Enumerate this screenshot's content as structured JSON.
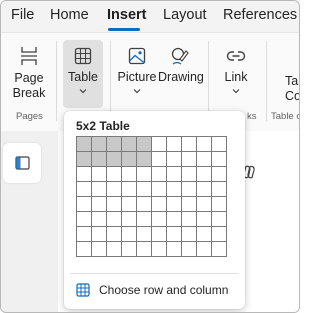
{
  "menubar": {
    "tabs": [
      {
        "label": "File"
      },
      {
        "label": "Home"
      },
      {
        "label": "Insert"
      },
      {
        "label": "Layout"
      },
      {
        "label": "References"
      }
    ],
    "active_tab": "Insert"
  },
  "ribbon": {
    "page_break": {
      "line1": "Page",
      "line2": "Break",
      "icon": "page-break-icon"
    },
    "table": {
      "label": "Table",
      "icon": "table-icon"
    },
    "picture": {
      "label": "Picture",
      "icon": "picture-icon"
    },
    "drawing": {
      "label": "Drawing",
      "icon": "drawing-icon"
    },
    "link": {
      "label": "Link",
      "icon": "link-icon"
    },
    "table_contents": {
      "line1": "Ta",
      "line2": "Co"
    },
    "groups": {
      "pages": "Pages",
      "links_partial": "ks",
      "table_contents_partial": "Table o"
    }
  },
  "table_dropdown": {
    "title": "5x2 Table",
    "grid": {
      "columns": 10,
      "rows": 8,
      "highlight_columns": 5,
      "highlight_rows": 2
    },
    "choose_label": "Choose row and column"
  },
  "colors": {
    "accent": "#0f6cbd",
    "grid_highlight": "#c8c8c8",
    "grid_line": "#7a7a7a"
  }
}
